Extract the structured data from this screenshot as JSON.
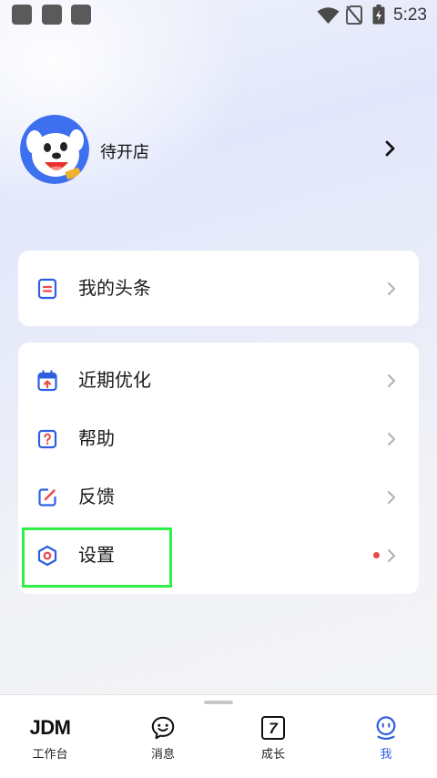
{
  "status_bar": {
    "time": "5:23",
    "icons": [
      "wifi-icon",
      "no-sim-icon",
      "battery-charging-icon"
    ]
  },
  "profile": {
    "name": "待开店"
  },
  "card_headline": {
    "items": [
      {
        "label": "我的头条",
        "icon": "headline-document-icon"
      }
    ]
  },
  "card_menu": {
    "items": [
      {
        "label": "近期优化",
        "icon": "calendar-icon"
      },
      {
        "label": "帮助",
        "icon": "help-icon"
      },
      {
        "label": "反馈",
        "icon": "feedback-edit-icon"
      },
      {
        "label": "设置",
        "icon": "settings-hexagon-icon",
        "badge_dot": true
      }
    ]
  },
  "bottom_nav": {
    "tabs": [
      {
        "label": "工作台",
        "logo_text": "JDM"
      },
      {
        "label": "消息",
        "icon": "message-smile-icon"
      },
      {
        "label": "成长",
        "icon_text": "7"
      },
      {
        "label": "我",
        "icon": "profile-face-icon",
        "active": true
      }
    ]
  },
  "colors": {
    "accent": "#2f5fdf",
    "icon_red": "#e84a4a",
    "highlight": "#2ef04a",
    "card_bg": "#ffffff"
  }
}
